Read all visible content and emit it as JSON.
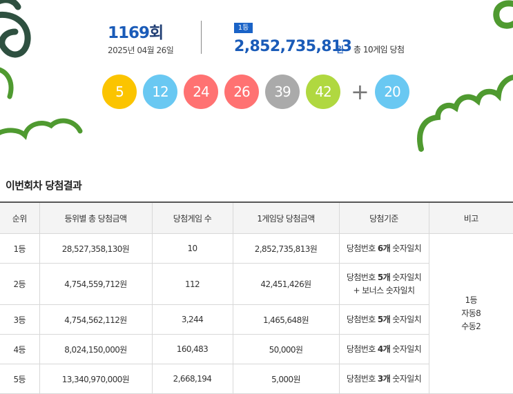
{
  "round": {
    "number": "1169",
    "suffix": "회",
    "date": "2025년 04월 26일"
  },
  "first_prize": {
    "badge": "1등",
    "amount": "2,852,735,813",
    "unit": "원",
    "winners": "총 10게임 당첨"
  },
  "balls": [
    {
      "value": "5",
      "color": "#fbc400"
    },
    {
      "value": "12",
      "color": "#69c8f2"
    },
    {
      "value": "24",
      "color": "#ff7272"
    },
    {
      "value": "26",
      "color": "#ff7272"
    },
    {
      "value": "39",
      "color": "#aaaaaa"
    },
    {
      "value": "42",
      "color": "#b0d840"
    }
  ],
  "plus_sign": "+",
  "bonus_ball": {
    "value": "20",
    "color": "#69c8f2"
  },
  "section_title": "이번회차 당첨결과",
  "table": {
    "headers": [
      "순위",
      "등위별 총 당첨금액",
      "당첨게임 수",
      "1게임당 당첨금액",
      "당첨기준",
      "비고"
    ],
    "rows": [
      {
        "rank": "1등",
        "total": "28,527,358,130원",
        "games": "10",
        "per_game": "2,852,735,813원",
        "crit_pre": "당첨번호 ",
        "crit_bold": "6개",
        "crit_post": " 숫자일치",
        "crit_line2": ""
      },
      {
        "rank": "2등",
        "total": "4,754,559,712원",
        "games": "112",
        "per_game": "42,451,426원",
        "crit_pre": "당첨번호 ",
        "crit_bold": "5개",
        "crit_post": " 숫자일치",
        "crit_line2": "+ 보너스 숫자일치"
      },
      {
        "rank": "3등",
        "total": "4,754,562,112원",
        "games": "3,244",
        "per_game": "1,465,648원",
        "crit_pre": "당첨번호 ",
        "crit_bold": "5개",
        "crit_post": " 숫자일치",
        "crit_line2": ""
      },
      {
        "rank": "4등",
        "total": "8,024,150,000원",
        "games": "160,483",
        "per_game": "50,000원",
        "crit_pre": "당첨번호 ",
        "crit_bold": "4개",
        "crit_post": " 숫자일치",
        "crit_line2": ""
      },
      {
        "rank": "5등",
        "total": "13,340,970,000원",
        "games": "2,668,194",
        "per_game": "5,000원",
        "crit_pre": "당첨번호 ",
        "crit_bold": "3개",
        "crit_post": " 숫자일치",
        "crit_line2": ""
      }
    ],
    "note": {
      "line1": "1등",
      "line2": "자동8",
      "line3": "수동2"
    }
  },
  "decoration_colors": {
    "dark_green": "#2e5040",
    "green": "#4f9a30",
    "badge_blue": "#1a63c7",
    "number_blue": "#1a5bb8"
  }
}
